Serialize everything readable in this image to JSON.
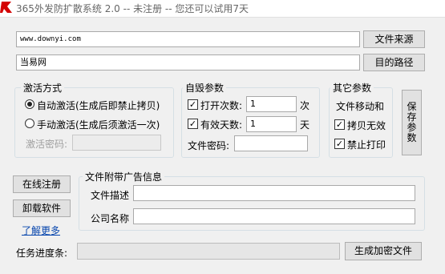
{
  "window": {
    "title": "365外发防扩散系统 2.0 -- 未注册 -- 您还可以试用7天",
    "icon": "app-logo-icon"
  },
  "source": {
    "url_value": "www.downyi.com",
    "source_button": "文件来源",
    "dest_value": "当易网",
    "dest_button": "目的路径"
  },
  "activation": {
    "title": "激活方式",
    "auto_label": "自动激活(生成后即禁止拷贝)",
    "manual_label": "手动激活(生成后须激活一次)",
    "selected": "auto",
    "password_label": "激活密码:",
    "password_value": ""
  },
  "selfdestruct": {
    "title": "自毁参数",
    "open_count_label": "打开次数:",
    "open_count_value": "1",
    "open_count_unit": "次",
    "open_count_checked": true,
    "valid_days_label": "有效天数:",
    "valid_days_value": "1",
    "valid_days_unit": "天",
    "valid_days_checked": true,
    "file_password_label": "文件密码:",
    "file_password_value": ""
  },
  "other": {
    "title": "其它参数",
    "file_move_label": "文件移动和",
    "copy_invalid_label": "拷贝无效",
    "copy_invalid_checked": true,
    "no_print_label": "禁止打印",
    "no_print_checked": true
  },
  "save_button": "保存参数",
  "side": {
    "register_button": "在线注册",
    "uninstall_button": "卸载软件",
    "learn_more_link": "了解更多"
  },
  "ad": {
    "title": "文件附带广告信息",
    "desc_label": "文件描述",
    "desc_value": "",
    "company_label": "公司名称",
    "company_value": ""
  },
  "footer": {
    "progress_label": "任务进度条:",
    "progress_value": 0,
    "generate_button": "生成加密文件"
  }
}
